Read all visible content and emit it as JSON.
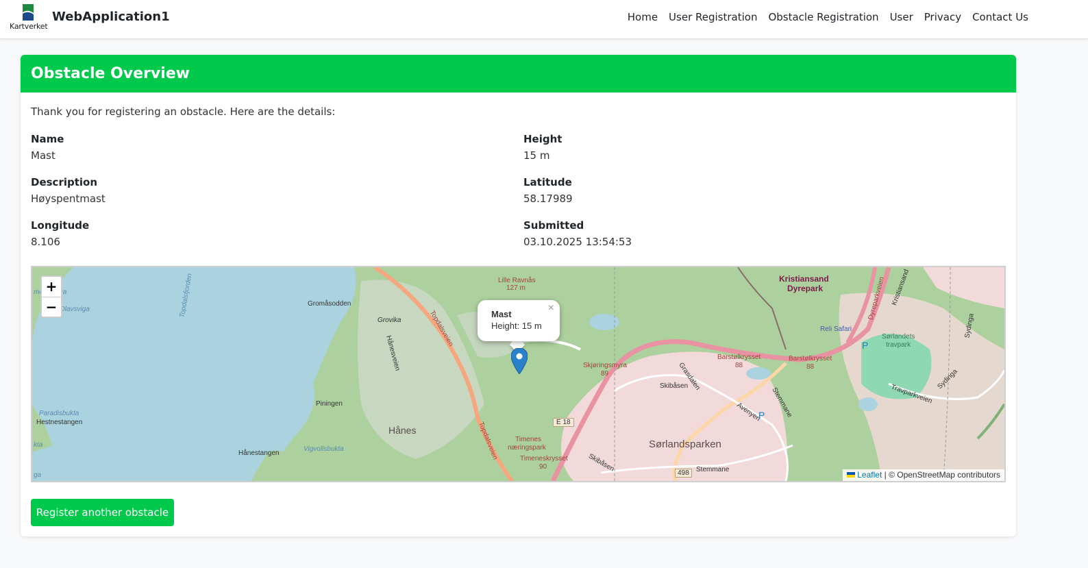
{
  "navbar": {
    "logo_text": "Kartverket",
    "brand": "WebApplication1",
    "links": [
      "Home",
      "User Registration",
      "Obstacle Registration",
      "User",
      "Privacy",
      "Contact Us"
    ]
  },
  "card": {
    "title": "Obstacle Overview",
    "intro": "Thank you for registering an obstacle. Here are the details:",
    "fields": {
      "name": {
        "label": "Name",
        "value": "Mast"
      },
      "height": {
        "label": "Height",
        "value": "15 m"
      },
      "description": {
        "label": "Description",
        "value": "Høyspentmast"
      },
      "latitude": {
        "label": "Latitude",
        "value": "58.17989"
      },
      "longitude": {
        "label": "Longitude",
        "value": "8.106"
      },
      "submitted": {
        "label": "Submitted",
        "value": "03.10.2025 13:54:53"
      }
    },
    "button": "Register another obstacle"
  },
  "map": {
    "zoom_in": "+",
    "zoom_out": "−",
    "popup": {
      "title": "Mast",
      "text": "Height: 15 m",
      "close": "×"
    },
    "attribution": {
      "leaflet": "Leaflet",
      "rest": " | © OpenStreetMap contributors"
    },
    "labels": {
      "gromasodden": "Gromåsodden",
      "lille_ravnas": "Lille Ravnås",
      "ravnas_ele": "127 m",
      "kristiansand_dyrepark_1": "Kristiansand",
      "kristiansand_dyrepark_2": "Dyrepark",
      "reli_safari": "Reli Safari",
      "grovika": "Grovika",
      "topdalsveien": "Topdalsveien",
      "topdalsveien2": "Topdalsveien",
      "hanesveien": "Hånesveien",
      "piningen": "Piningen",
      "hanes": "Hånes",
      "hanestangen": "Hånestangen",
      "vigvollsbukta": "Vigvollsbukta",
      "paradisbukta": "Paradisbukta",
      "hestnestangen": "Hestnestangen",
      "mundsviga": "mundsviga",
      "olavsviga": "Olavsviga",
      "topdalsfjorden": "Topdalsfjorden",
      "skjoringsmyra": "Skjøringsmyra",
      "skjoringsmyra_num": "89",
      "e18": "E 18",
      "barstolkrysset1": "Barstølkrysset",
      "barstolkrysset2": "Barstølkrysset",
      "krysset_num1": "88",
      "krysset_num2": "88",
      "timenes1": "Timenes",
      "timenes2": "næringspark",
      "timeneskrysset": "Timeneskrysset",
      "timeneskrysset_num": "90",
      "sorlandsparken": "Sørlandsparken",
      "skibasen": "Skibåsen",
      "skibasen2": "Skibåsen",
      "grasdalen": "Grasdalen",
      "avenyen": "Avenyen",
      "stemmane": "Stemmane",
      "stemmane2": "Stemmane",
      "road_498": "498",
      "travparkveien": "Travparkveien",
      "sorlandets_travpark1": "Sørlandets",
      "sorlandets_travpark2": "travpark",
      "sydinga": "Sydinga",
      "sydinga2": "Sydinga",
      "dyreparkveien": "Dyreparkveien",
      "kristiansandsv": "Kristiansand",
      "kta": "kta",
      "ga": "ga",
      "parking": "P"
    }
  }
}
